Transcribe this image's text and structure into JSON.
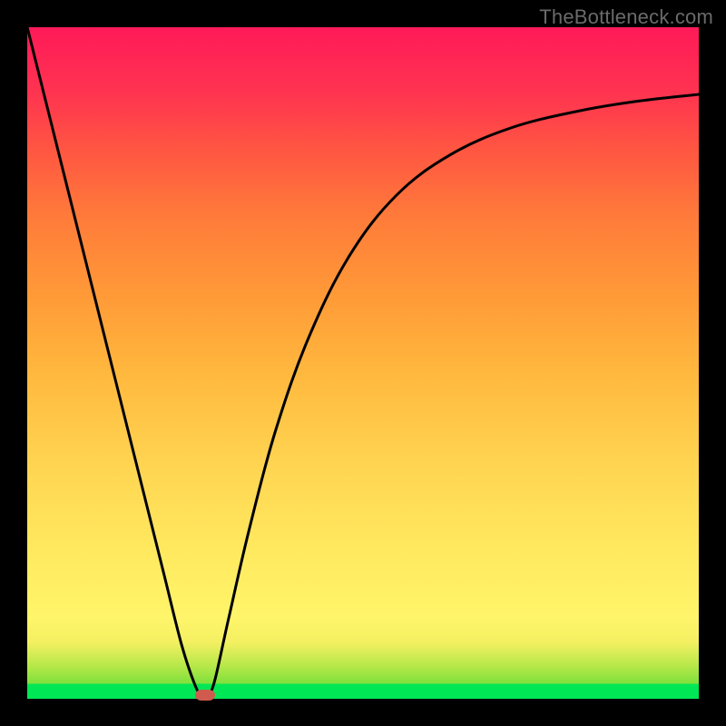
{
  "watermark": "TheBottleneck.com",
  "chart_data": {
    "type": "line",
    "title": "",
    "xlabel": "",
    "ylabel": "",
    "xlim": [
      0,
      1
    ],
    "ylim": [
      0,
      1
    ],
    "grid": false,
    "legend": false,
    "series": [
      {
        "name": "bottleneck-curve",
        "x": [
          0.0,
          0.05,
          0.1,
          0.15,
          0.2,
          0.23,
          0.25,
          0.26,
          0.265,
          0.27,
          0.28,
          0.3,
          0.33,
          0.37,
          0.42,
          0.48,
          0.55,
          0.63,
          0.72,
          0.82,
          0.91,
          1.0
        ],
        "y": [
          1.0,
          0.8,
          0.6,
          0.4,
          0.2,
          0.08,
          0.02,
          0.003,
          0.0,
          0.003,
          0.03,
          0.12,
          0.25,
          0.4,
          0.54,
          0.66,
          0.75,
          0.81,
          0.85,
          0.875,
          0.89,
          0.9
        ]
      }
    ],
    "annotations": [
      {
        "name": "min-marker",
        "x": 0.265,
        "y": 0.0,
        "label": ""
      }
    ],
    "background_gradient": {
      "top": "#ff1a58",
      "mid": "#ffb93e",
      "bottom_band": "#f4f062",
      "base": "#00e756"
    }
  }
}
